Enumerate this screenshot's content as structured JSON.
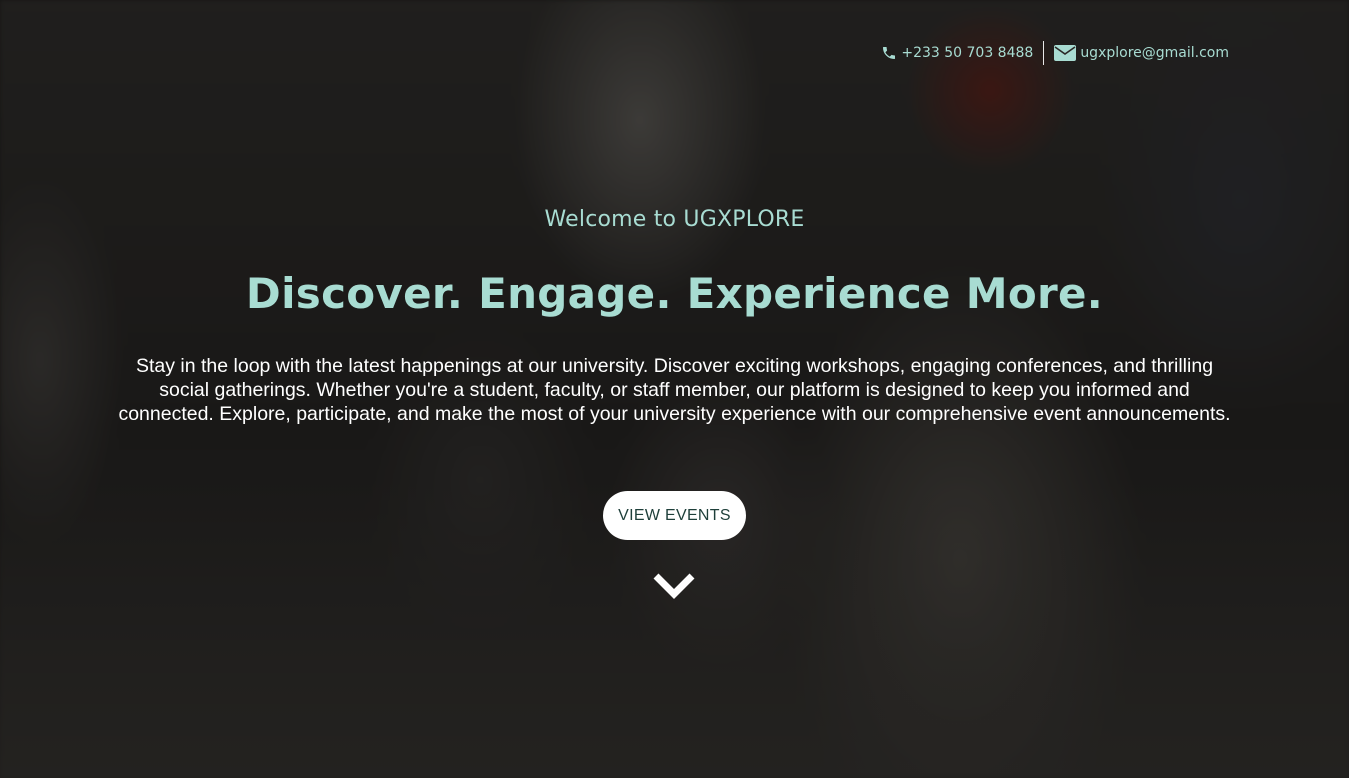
{
  "contact": {
    "phone": "+233 50 703 8488",
    "email": "ugxplore@gmail.com",
    "phone_icon": "phone-icon",
    "email_icon": "envelope-icon"
  },
  "hero": {
    "welcome": "Welcome to UGXPLORE",
    "headline": "Discover. Engage. Experience More.",
    "description": "Stay in the loop with the latest happenings at our university. Discover exciting workshops, engaging conferences, and thrilling social gatherings. Whether you're a student, faculty, or staff member, our platform is designed to keep you informed and connected. Explore, participate, and make the most of your university experience with our comprehensive event announcements.",
    "cta_label": "VIEW EVENTS",
    "scroll_icon": "chevron-down-icon"
  },
  "colors": {
    "accent": "#a8dcd2",
    "overlay": "#000000",
    "button_bg": "#ffffff",
    "button_text": "#1e3f3a"
  }
}
